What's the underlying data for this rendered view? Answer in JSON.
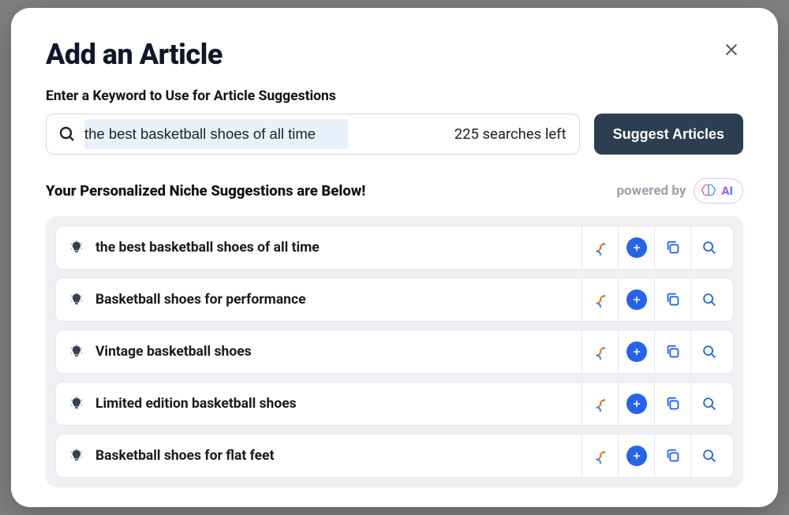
{
  "modal": {
    "title": "Add an Article",
    "sub_label": "Enter a Keyword to Use for Article Suggestions",
    "search_value": "the best basketball shoes of all time",
    "searches_left": "225 searches left",
    "suggest_button": "Suggest Articles",
    "results_title": "Your Personalized Niche Suggestions are Below!",
    "powered_by": "powered by",
    "ai_label": "AI"
  },
  "suggestions": [
    {
      "text": "the best basketball shoes of all time"
    },
    {
      "text": "Basketball shoes for performance"
    },
    {
      "text": "Vintage basketball shoes"
    },
    {
      "text": "Limited edition basketball shoes"
    },
    {
      "text": "Basketball shoes for flat feet"
    }
  ],
  "colors": {
    "button_bg": "#2c3e50",
    "accent_blue": "#2563eb",
    "panel_bg": "#eef0f3"
  }
}
